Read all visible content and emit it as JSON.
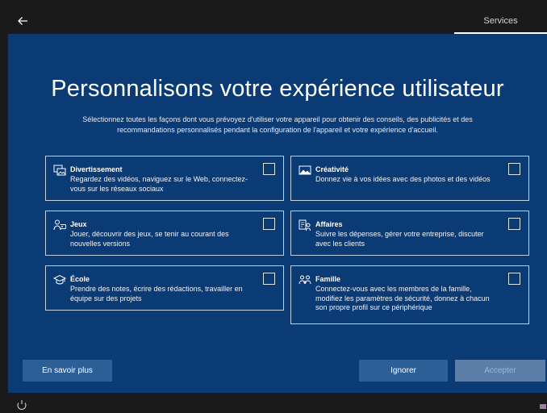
{
  "window": {
    "step_label": "Services",
    "back_icon": "arrow-left-icon"
  },
  "heading": {
    "title": "Personnalisons votre expérience utilisateur",
    "subtitle": "Sélectionnez toutes les façons dont vous prévoyez d'utiliser votre appareil pour obtenir des conseils, des publicités et des recommandations personnalisés pendant la configuration de l'appareil et votre expérience d'accueil."
  },
  "options": [
    {
      "id": "divertissement",
      "title": "Divertissement",
      "description": "Regardez des vidéos, naviguez sur le Web, connectez-vous sur les réseaux sociaux",
      "icon": "photos-entertainment-icon",
      "checked": false
    },
    {
      "id": "creativite",
      "title": "Créativité",
      "description": "Donnez vie à vos idées avec des photos et des vidéos",
      "icon": "picture-creativity-icon",
      "checked": false
    },
    {
      "id": "jeux",
      "title": "Jeux",
      "description": "Jouer, découvrir des jeux, se tenir au courant des nouvelles versions",
      "icon": "gaming-icon",
      "checked": false
    },
    {
      "id": "affaires",
      "title": "Affaires",
      "description": "Suivre les dépenses, gérer votre entreprise, discuter avec les clients",
      "icon": "business-icon",
      "checked": false
    },
    {
      "id": "ecole",
      "title": "École",
      "description": "Prendre des notes, écrire des rédactions, travailler en équipe sur des projets",
      "icon": "graduation-cap-icon",
      "checked": false
    },
    {
      "id": "famille",
      "title": "Famille",
      "description": "Connectez-vous avec les membres de la famille, modifiez les paramètres de sécurité, donnez à chacun son propre profil sur ce périphérique",
      "icon": "family-people-icon",
      "checked": false
    }
  ],
  "footer": {
    "learn_more": "En savoir plus",
    "ignore": "Ignorer",
    "accept": "Accepter",
    "accept_enabled": false
  },
  "taskbar": {
    "ease_of_access_icon": "ease-of-access-icon",
    "keyboard_icon": "keyboard-layout-icon"
  },
  "colors": {
    "background": "#0b3b75",
    "button": "#2d5f97",
    "button_disabled": "#5a7ea8"
  }
}
